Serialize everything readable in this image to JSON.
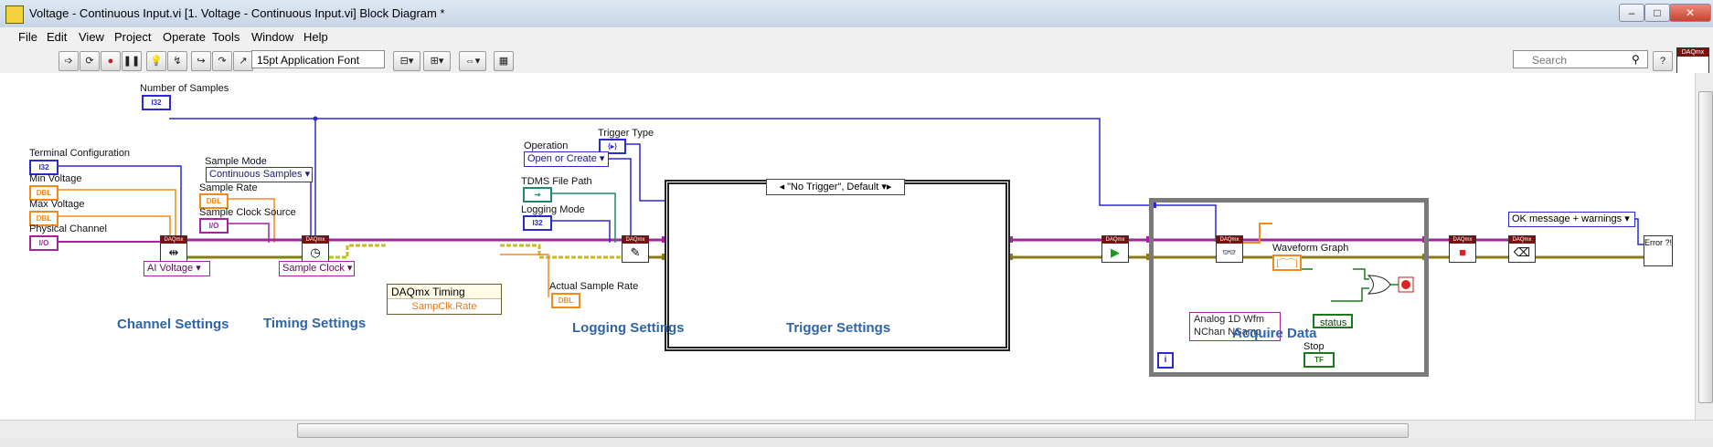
{
  "window": {
    "title": "Voltage - Continuous Input.vi [1. Voltage - Continuous Input.vi] Block Diagram *",
    "min_label": "–",
    "max_label": "□",
    "close_label": "✕"
  },
  "menu": [
    "File",
    "Edit",
    "View",
    "Project",
    "Operate",
    "Tools",
    "Window",
    "Help"
  ],
  "toolbar": {
    "font": "15pt Application Font",
    "search_placeholder": "Search",
    "help_label": "?",
    "daqmx_example": "DAQmx"
  },
  "diagram": {
    "labels": {
      "number_of_samples": "Number of Samples",
      "terminal_configuration": "Terminal Configuration",
      "min_voltage": "Min Voltage",
      "max_voltage": "Max Voltage",
      "physical_channel": "Physical Channel",
      "sample_mode": "Sample Mode",
      "sample_rate": "Sample Rate",
      "sample_clock_source": "Sample Clock Source",
      "trigger_type": "Trigger Type",
      "operation": "Operation",
      "tdms_file_path": "TDMS File Path",
      "logging_mode": "Logging Mode",
      "actual_sample_rate": "Actual Sample Rate",
      "waveform_graph": "Waveform Graph",
      "stop": "Stop"
    },
    "terminals": {
      "i32": "I32",
      "dbl": "DBL",
      "io": "I/O",
      "path": "⇝",
      "tf": "TF",
      "trig": "⟨▸⟩",
      "wfm": "[⌒⌒]",
      "iter": "i"
    },
    "enums": {
      "sample_mode": "Continuous Samples",
      "operation": "Open or Create",
      "ai_voltage": "AI Voltage",
      "sample_clock": "Sample Clock",
      "read_poly_1": "Analog 1D Wfm",
      "read_poly_2": "NChan NSamp",
      "error_msg": "OK message + warnings"
    },
    "nodes": {
      "header": "DAQmx",
      "timing_title": "DAQmx Timing",
      "timing_property": "SampClk.Rate",
      "error_text": "Error ?!",
      "status": "status"
    },
    "case_selector": "\"No Trigger\", Default",
    "sections": {
      "channel": "Channel Settings",
      "timing": "Timing Settings",
      "logging": "Logging Settings",
      "trigger": "Trigger Settings",
      "acquire": "Acquire Data"
    }
  },
  "colors": {
    "int_wire": "#2a2ad0",
    "dbl_wire": "#f08a1c",
    "io_wire": "#a4239e",
    "err_wire": "#8a7a1a",
    "section_label": "#2f65a8"
  }
}
